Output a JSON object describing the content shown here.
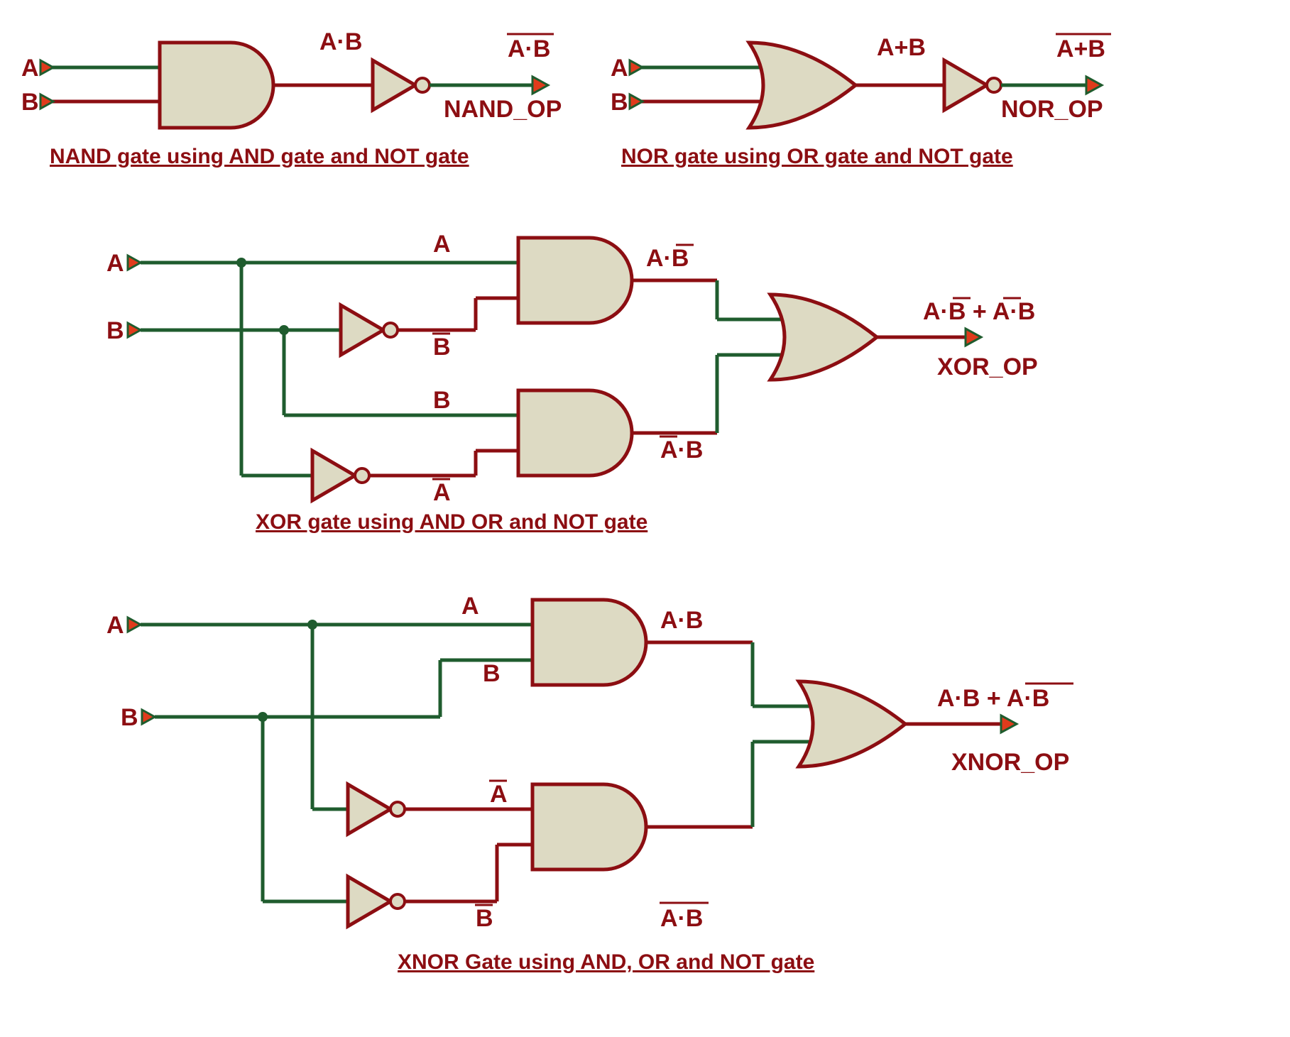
{
  "nand": {
    "inA": "A",
    "inB": "B",
    "mid": "A·B",
    "out": "A·B",
    "outName": "NAND_OP",
    "caption": "NAND gate using AND gate and NOT gate"
  },
  "nor": {
    "inA": "A",
    "inB": "B",
    "mid": "A+B",
    "out": "A+B",
    "outName": "NOR_OP",
    "caption": "NOR gate using OR gate and NOT gate"
  },
  "xor": {
    "inA": "A",
    "inB": "B",
    "wireA": "A",
    "wireNotB": "B",
    "wireB": "B",
    "wireNotA": "A",
    "and1": "A·B",
    "and2": "A·B",
    "outExpr": "A·B + A·B",
    "outName": "XOR_OP",
    "caption": "XOR gate using AND OR and NOT gate"
  },
  "xnor": {
    "inA": "A",
    "inB": "B",
    "wireA": "A",
    "wireB": "B",
    "wireNotA": "A",
    "wireNotB": "B",
    "and1": "A·B",
    "and2": "A·B",
    "outExpr": "A·B +  A·B",
    "outName": "XNOR_OP",
    "caption": "XNOR Gate using AND, OR and NOT gate"
  }
}
